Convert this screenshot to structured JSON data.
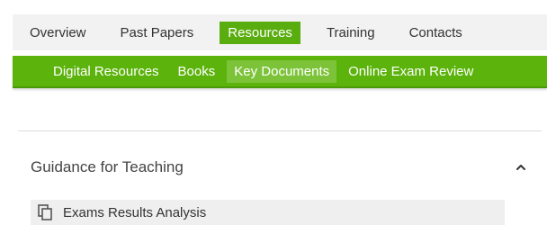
{
  "main_nav": {
    "items": [
      {
        "label": "Overview"
      },
      {
        "label": "Past Papers"
      },
      {
        "label": "Resources"
      },
      {
        "label": "Training"
      },
      {
        "label": "Contacts"
      }
    ],
    "active_label": "Resources"
  },
  "sub_nav": {
    "items": [
      {
        "label": "Digital Resources"
      },
      {
        "label": "Books"
      },
      {
        "label": "Key Documents"
      },
      {
        "label": "Online Exam Review"
      }
    ],
    "active_label": "Key Documents"
  },
  "accordion": {
    "title": "Guidance for Teaching",
    "toggle_icon": "chevron-up-icon",
    "items": [
      {
        "label": "Exams Results Analysis",
        "icon": "copy-icon"
      }
    ]
  },
  "colors": {
    "primary_green": "#5aad0f",
    "sub_nav_green": "#5cb30c",
    "active_sub_item": "#7dc33a",
    "nav_background": "#f2f2f2"
  }
}
